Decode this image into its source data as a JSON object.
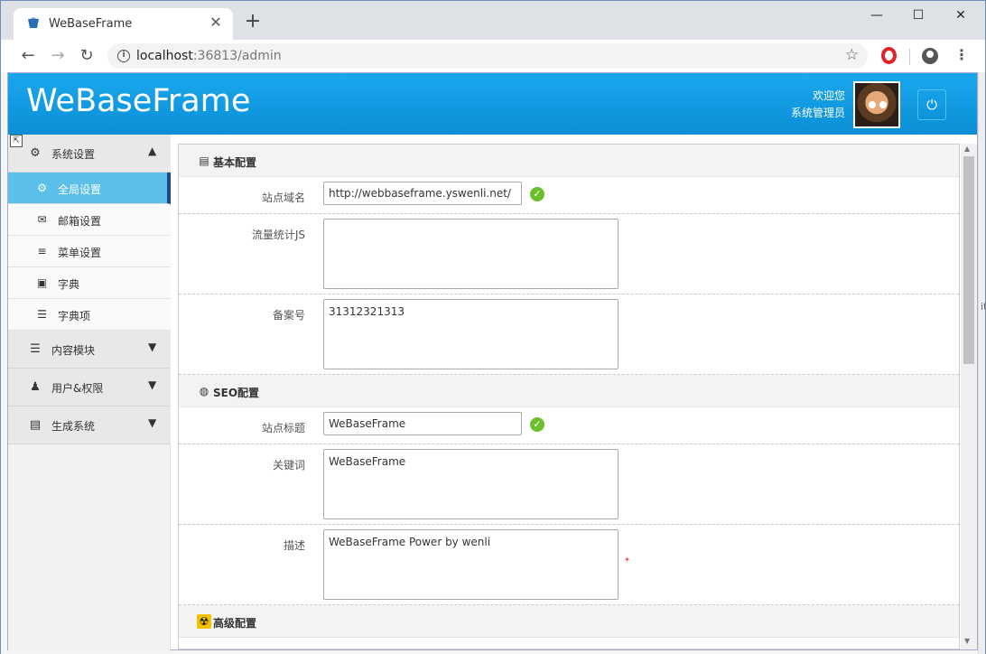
{
  "browser": {
    "tab_title": "WeBaseFrame",
    "new_tab": "+",
    "url_host": "localhost",
    "url_rest": ":36813/admin",
    "win_min": "—",
    "win_max": "☐",
    "win_close": "✕"
  },
  "header": {
    "brand": "WeBaseFrame",
    "welcome_line1": "欢迎您",
    "welcome_line2": "系统管理员",
    "power": "⏻"
  },
  "sidebar": {
    "groups": [
      {
        "label": "系统设置",
        "icon": "gear-icon",
        "expanded": true
      },
      {
        "label": "内容模块",
        "icon": "list-icon",
        "expanded": false
      },
      {
        "label": "用户&权限",
        "icon": "user-icon",
        "expanded": false
      },
      {
        "label": "生成系统",
        "icon": "document-icon",
        "expanded": false
      }
    ],
    "items": [
      {
        "label": "全局设置",
        "icon": "gear-icon",
        "active": true
      },
      {
        "label": "邮箱设置",
        "icon": "mail-icon",
        "active": false
      },
      {
        "label": "菜单设置",
        "icon": "menu-icon",
        "active": false
      },
      {
        "label": "字典",
        "icon": "dictionary-icon",
        "active": false
      },
      {
        "label": "字典项",
        "icon": "list-icon",
        "active": false
      }
    ]
  },
  "form": {
    "sections": {
      "basic": "基本配置",
      "seo": "SEO配置",
      "advanced": "高级配置"
    },
    "fields": {
      "site_domain": {
        "label": "站点域名",
        "value": "http://webbaseframe.yswenli.net/"
      },
      "stats_js": {
        "label": "流量统计JS",
        "value": ""
      },
      "icp": {
        "label": "备案号",
        "value": "31312321313"
      },
      "site_title": {
        "label": "站点标题",
        "value": "WeBaseFrame"
      },
      "keywords": {
        "label": "关键词",
        "value": "WeBaseFrame"
      },
      "description": {
        "label": "描述",
        "value": "WeBaseFrame Power by wenli",
        "required_mark": "*"
      }
    }
  },
  "side_edge_text": "it"
}
